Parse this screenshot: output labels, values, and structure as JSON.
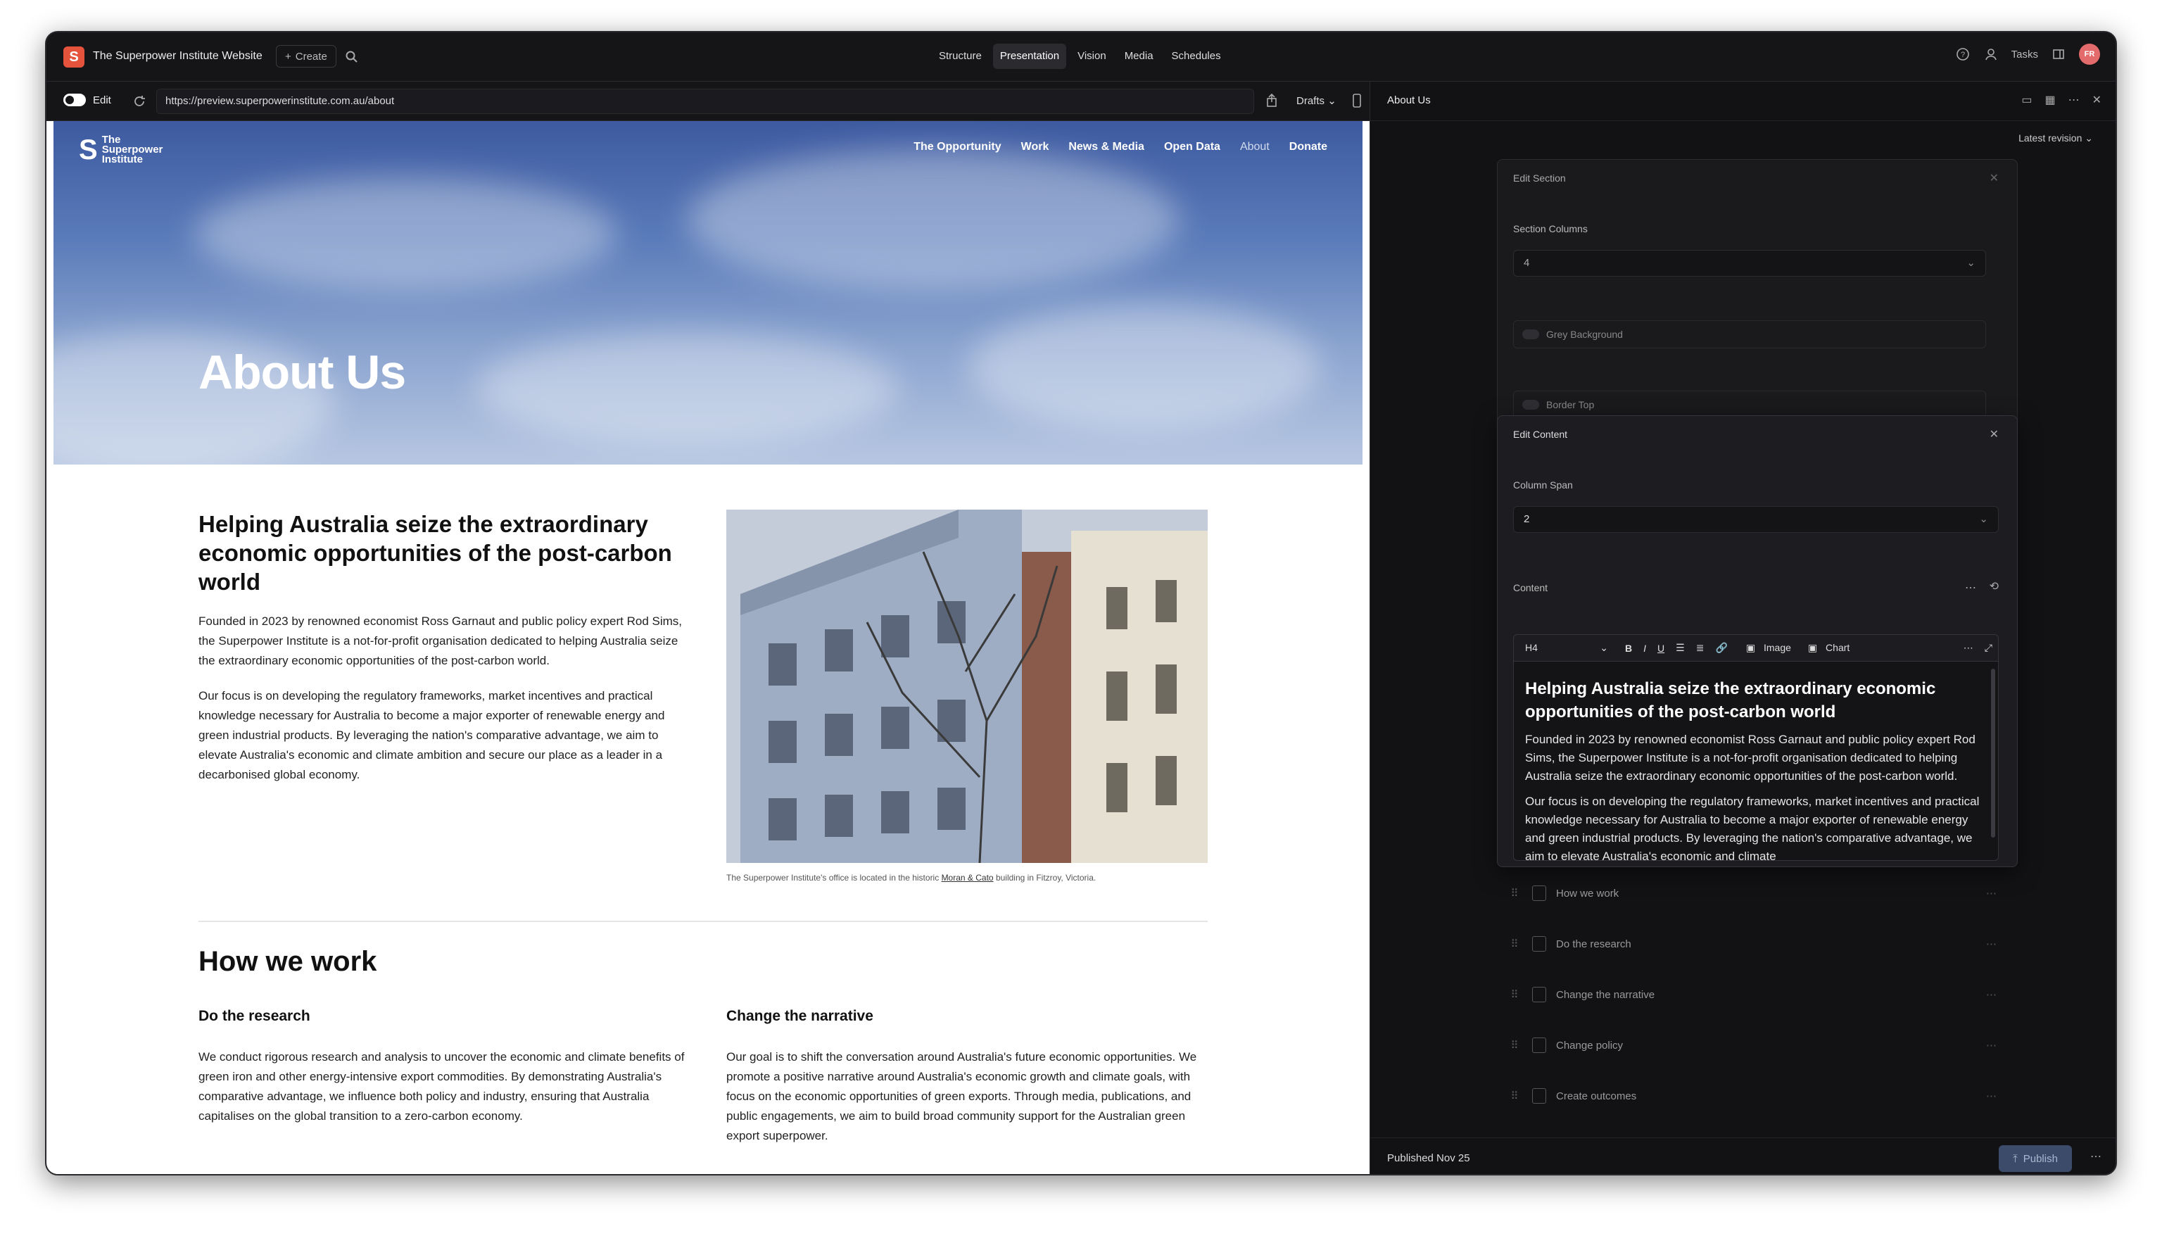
{
  "topbar": {
    "logo_letter": "S",
    "site_name": "The Superpower Institute Website",
    "create_label": "Create",
    "nav": [
      "Structure",
      "Presentation",
      "Vision",
      "Media",
      "Schedules"
    ],
    "active_nav": "Presentation",
    "tasks_label": "Tasks",
    "avatar_initials": "FR"
  },
  "urlbar": {
    "edit_label": "Edit",
    "url": "https://preview.superpowerinstitute.com.au/about",
    "drafts_label": "Drafts"
  },
  "site": {
    "logo_mark": "S",
    "logo_line1": "The",
    "logo_line2": "Superpower",
    "logo_line3": "Institute",
    "nav": [
      "The Opportunity",
      "Work",
      "News & Media",
      "Open Data",
      "About",
      "Donate"
    ],
    "hero_title": "About Us",
    "heading": "Helping Australia seize the extraordinary economic opportunities of the post-carbon world",
    "para1": "Founded in 2023 by renowned economist Ross Garnaut and public policy expert Rod Sims, the Superpower Institute is a not-for-profit organisation dedicated to helping Australia seize the extraordinary economic opportunities of the post-carbon world.",
    "para2": "Our focus is on developing the regulatory frameworks, market incentives and practical knowledge necessary for Australia to become a major exporter of renewable energy and green industrial products. By leveraging the nation's comparative advantage, we aim to elevate Australia's economic and climate ambition and secure our place as a leader in a decarbonised global economy.",
    "caption_pre": "The Superpower Institute's office is located in the historic ",
    "caption_link": "Moran & Cato",
    "caption_post": " building in Fitzroy, Victoria.",
    "how_title": "How we work",
    "research_title": "Do the research",
    "research_text": "We conduct rigorous research and analysis to uncover the economic and climate benefits of green iron and other energy-intensive export commodities. By demonstrating Australia's comparative advantage, we influence both policy and industry, ensuring that Australia capitalises on the global transition to a zero-carbon economy.",
    "narrative_title": "Change the narrative",
    "narrative_text": "Our goal is to shift the conversation around Australia's future economic opportunities. We promote a positive narrative around Australia's economic growth and climate goals, with focus on the economic opportunities of green exports. Through media, publications, and public engagements, we aim to build broad community support for the Australian green export superpower."
  },
  "panel": {
    "title": "About Us",
    "revision": "Latest revision",
    "edit_section": {
      "title": "Edit Section",
      "columns_label": "Section Columns",
      "columns_value": "4",
      "grey_bg": "Grey Background",
      "border_top": "Border Top"
    },
    "edit_content": {
      "title": "Edit Content",
      "span_label": "Column Span",
      "span_value": "2",
      "content_label": "Content",
      "format": "H4",
      "image_btn": "Image",
      "chart_btn": "Chart",
      "editor_heading": "Helping Australia seize the extraordinary economic opportunities of the post-carbon world",
      "editor_p1": "Founded in 2023 by renowned economist Ross Garnaut and public policy expert Rod Sims, the Superpower Institute is a not-for-profit organisation dedicated to helping Australia seize the extraordinary economic opportunities of the post-carbon world.",
      "editor_p2": "Our focus is on developing the regulatory frameworks, market incentives and practical knowledge necessary for Australia to become a major exporter of renewable energy and green industrial products. By leveraging the nation's comparative advantage, we aim to elevate Australia's economic and climate"
    },
    "list": [
      "How we work",
      "Do the research",
      "Change the narrative",
      "Change policy",
      "Create outcomes"
    ],
    "published": "Published Nov 25",
    "publish_btn": "Publish"
  },
  "colors": {
    "accent": "#e5533d",
    "panel_bg": "#121215",
    "hero_blue": "#4a68ab"
  }
}
